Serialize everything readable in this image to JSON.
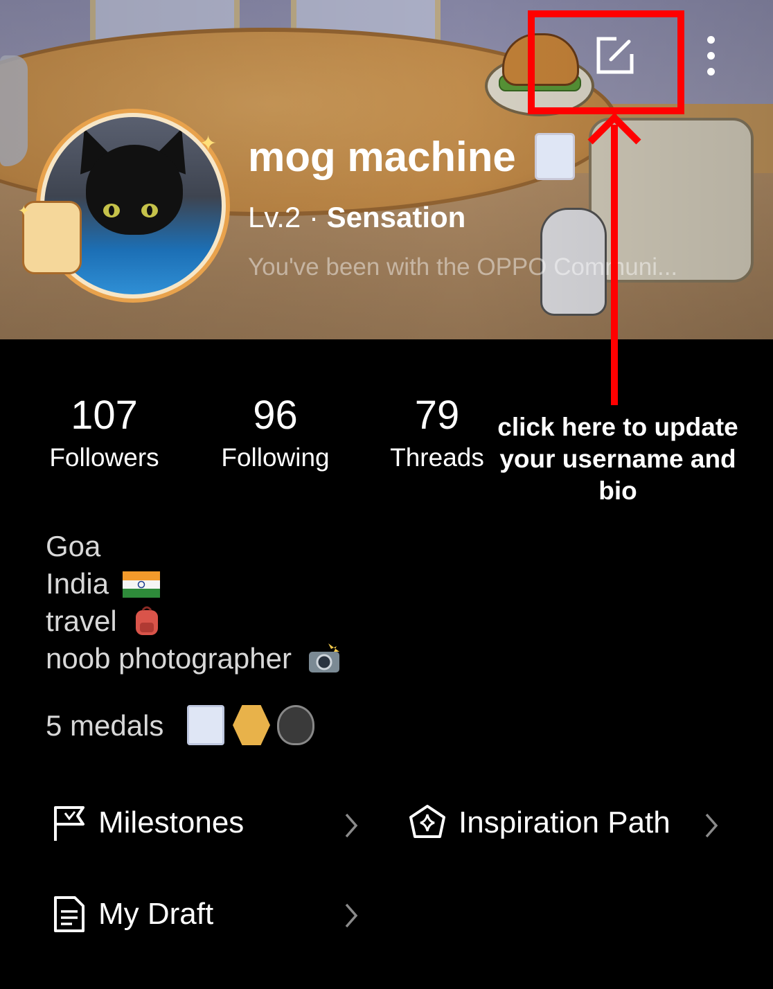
{
  "profile": {
    "username": "mog machine",
    "level": "Lv.2",
    "level_separator": " · ",
    "title": "Sensation",
    "bio_preview": "You've been with the OPPO Communi..."
  },
  "stats": [
    {
      "value": "107",
      "label": "Followers"
    },
    {
      "value": "96",
      "label": "Following"
    },
    {
      "value": "79",
      "label": "Threads"
    }
  ],
  "bio_lines": [
    "Goa",
    "India",
    "travel",
    "noob photographer"
  ],
  "bio_emoji": {
    "india": "india-flag-icon",
    "travel": "backpack-icon",
    "photographer": "camera-flash-icon"
  },
  "medals": {
    "label": "5 medals",
    "icons": [
      "duck-medal-icon",
      "number-2-medal-icon",
      "hat-medal-icon"
    ]
  },
  "menu": {
    "milestones": "Milestones",
    "inspiration": "Inspiration Path",
    "draft": "My Draft"
  },
  "annotation": {
    "text": "click here to update your username and bio",
    "color": "#ff0000"
  },
  "icons": {
    "edit": "edit-icon",
    "more": "more-vertical-icon"
  }
}
